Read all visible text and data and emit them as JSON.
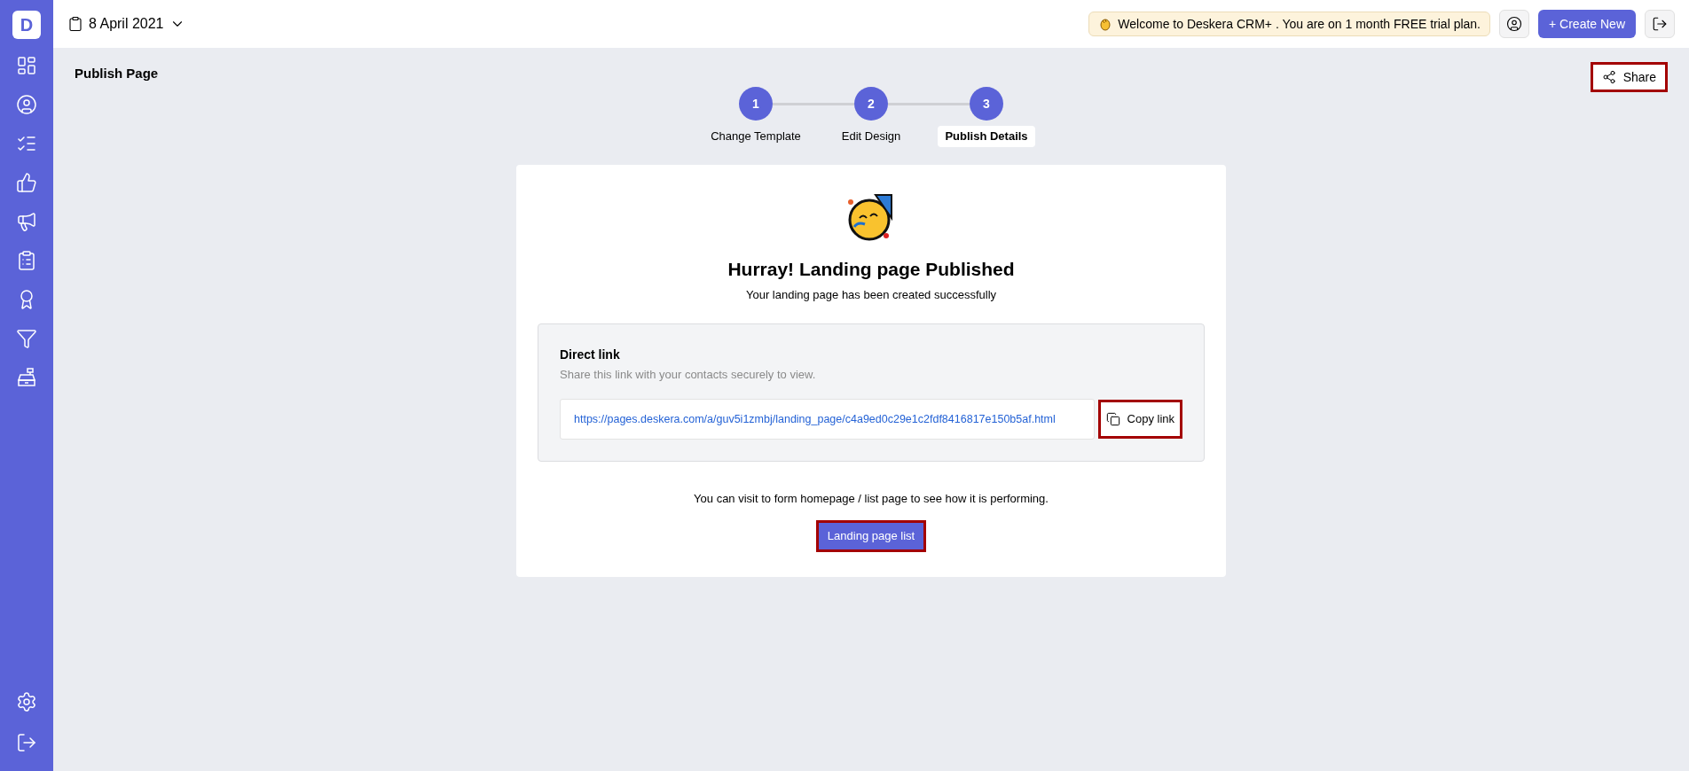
{
  "topbar": {
    "date": "8 April 2021",
    "welcome": "Welcome to Deskera CRM+ . You are on 1 month FREE trial plan.",
    "create_button": "+ Create New"
  },
  "logo": "D",
  "page": {
    "title": "Publish Page",
    "share_button": {
      "label": "Share",
      "highlighted": true
    }
  },
  "steps": [
    {
      "number": "1",
      "label": "Change Template",
      "selected": false
    },
    {
      "number": "2",
      "label": "Edit Design",
      "selected": false
    },
    {
      "number": "3",
      "label": "Publish Details",
      "selected": true
    }
  ],
  "card": {
    "heading": "Hurray! Landing page Published",
    "subheading": "Your landing page has been created successfully",
    "direct_link": {
      "title": "Direct link",
      "description": "Share this link with your contacts securely to view.",
      "url": "https://pages.deskera.com/a/guv5i1zmbj/landing_page/c4a9ed0c29e1c2fdf8416817e150b5af.html",
      "copy_button": {
        "label": "Copy link",
        "highlighted": true
      }
    },
    "note": "You can visit to form homepage / list page to see how it is performing.",
    "list_button": {
      "label": "Landing page list",
      "highlighted": true
    }
  }
}
